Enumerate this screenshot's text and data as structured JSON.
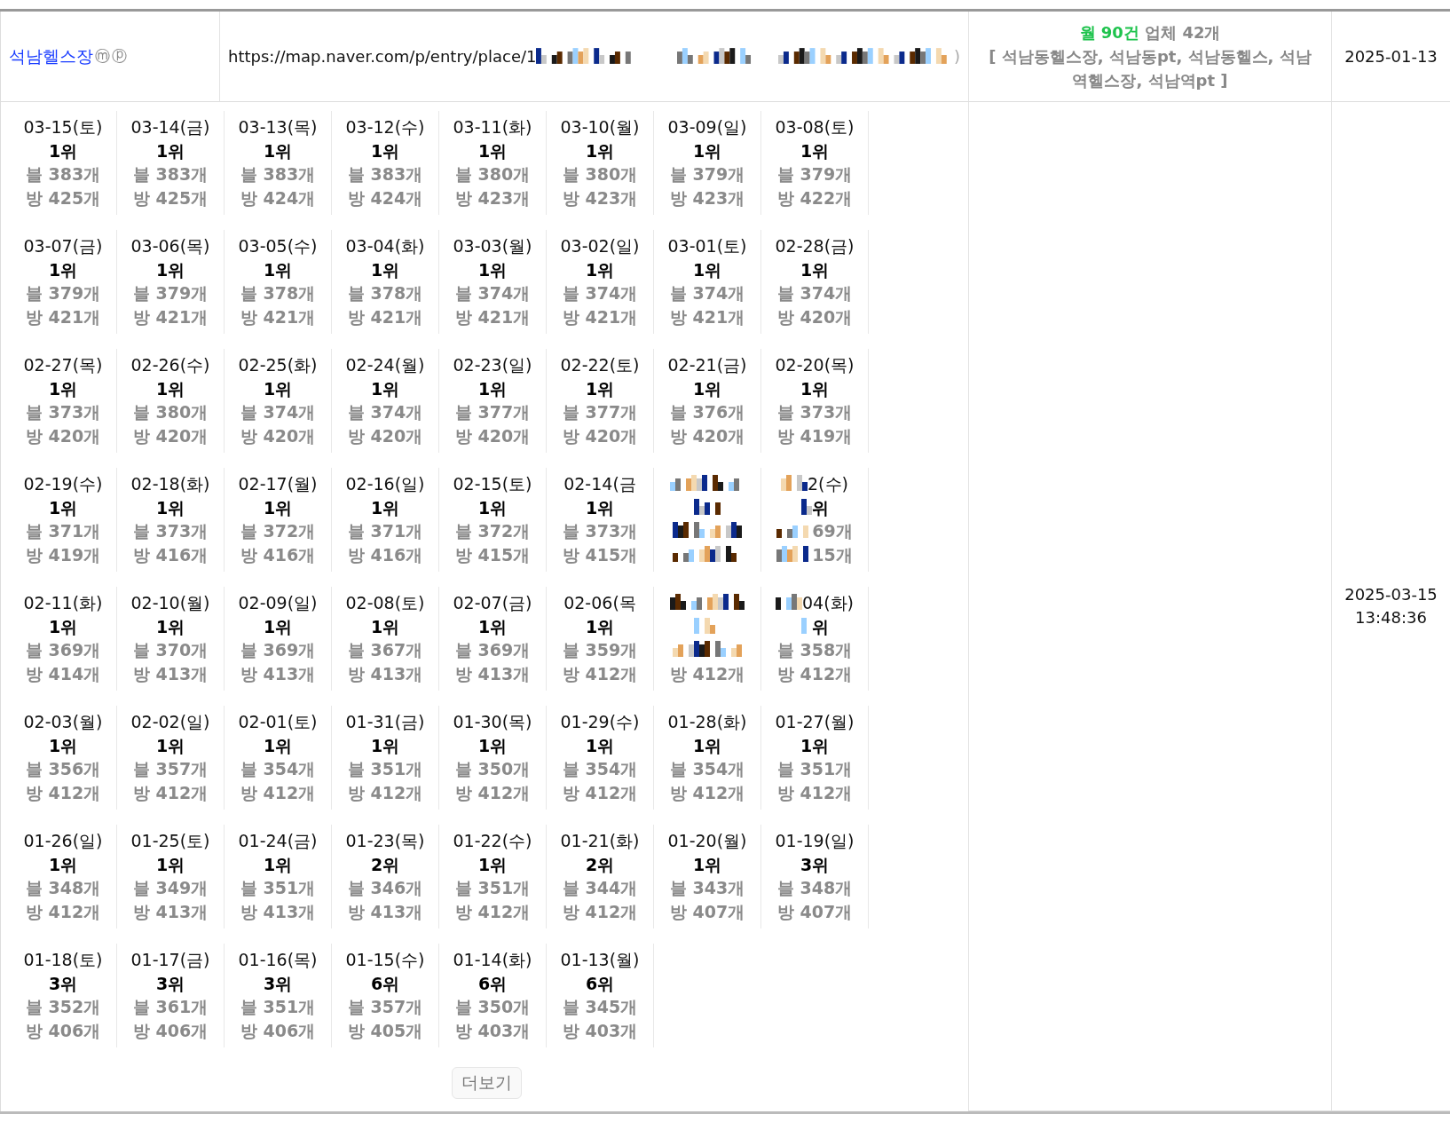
{
  "place_row": {
    "name": "석남헬스장",
    "badges": [
      "ⓜ",
      "ⓟ"
    ],
    "url": "https://map.naver.com/p/entry/place/1",
    "url_tail": ")",
    "monthly": "월 90건",
    "companies": "업체 42개",
    "keywords": "[ 석남동헬스장, 석남동pt, 석남동헬스, 석남역헬스장, 석남역pt ]",
    "start_date": "2025-01-13"
  },
  "rank_row": {
    "timestamp": "2025-03-15 13:48:36",
    "more_button": "더보기",
    "cells": [
      {
        "date": "03-15(토)",
        "rank": "1위",
        "blog": "블 383개",
        "place": "방 425개"
      },
      {
        "date": "03-14(금)",
        "rank": "1위",
        "blog": "블 383개",
        "place": "방 425개"
      },
      {
        "date": "03-13(목)",
        "rank": "1위",
        "blog": "블 383개",
        "place": "방 424개"
      },
      {
        "date": "03-12(수)",
        "rank": "1위",
        "blog": "블 383개",
        "place": "방 424개"
      },
      {
        "date": "03-11(화)",
        "rank": "1위",
        "blog": "블 380개",
        "place": "방 423개"
      },
      {
        "date": "03-10(월)",
        "rank": "1위",
        "blog": "블 380개",
        "place": "방 423개"
      },
      {
        "date": "03-09(일)",
        "rank": "1위",
        "blog": "블 379개",
        "place": "방 423개"
      },
      {
        "date": "03-08(토)",
        "rank": "1위",
        "blog": "블 379개",
        "place": "방 422개"
      },
      {
        "date": "03-07(금)",
        "rank": "1위",
        "blog": "블 379개",
        "place": "방 421개"
      },
      {
        "date": "03-06(목)",
        "rank": "1위",
        "blog": "블 379개",
        "place": "방 421개"
      },
      {
        "date": "03-05(수)",
        "rank": "1위",
        "blog": "블 378개",
        "place": "방 421개"
      },
      {
        "date": "03-04(화)",
        "rank": "1위",
        "blog": "블 378개",
        "place": "방 421개"
      },
      {
        "date": "03-03(월)",
        "rank": "1위",
        "blog": "블 374개",
        "place": "방 421개"
      },
      {
        "date": "03-02(일)",
        "rank": "1위",
        "blog": "블 374개",
        "place": "방 421개"
      },
      {
        "date": "03-01(토)",
        "rank": "1위",
        "blog": "블 374개",
        "place": "방 421개"
      },
      {
        "date": "02-28(금)",
        "rank": "1위",
        "blog": "블 374개",
        "place": "방 420개"
      },
      {
        "date": "02-27(목)",
        "rank": "1위",
        "blog": "블 373개",
        "place": "방 420개"
      },
      {
        "date": "02-26(수)",
        "rank": "1위",
        "blog": "블 380개",
        "place": "방 420개"
      },
      {
        "date": "02-25(화)",
        "rank": "1위",
        "blog": "블 374개",
        "place": "방 420개"
      },
      {
        "date": "02-24(월)",
        "rank": "1위",
        "blog": "블 374개",
        "place": "방 420개"
      },
      {
        "date": "02-23(일)",
        "rank": "1위",
        "blog": "블 377개",
        "place": "방 420개"
      },
      {
        "date": "02-22(토)",
        "rank": "1위",
        "blog": "블 377개",
        "place": "방 420개"
      },
      {
        "date": "02-21(금)",
        "rank": "1위",
        "blog": "블 376개",
        "place": "방 420개"
      },
      {
        "date": "02-20(목)",
        "rank": "1위",
        "blog": "블 373개",
        "place": "방 419개"
      },
      {
        "date": "02-19(수)",
        "rank": "1위",
        "blog": "블 371개",
        "place": "방 419개"
      },
      {
        "date": "02-18(화)",
        "rank": "1위",
        "blog": "블 373개",
        "place": "방 416개"
      },
      {
        "date": "02-17(월)",
        "rank": "1위",
        "blog": "블 372개",
        "place": "방 416개"
      },
      {
        "date": "02-16(일)",
        "rank": "1위",
        "blog": "블 371개",
        "place": "방 416개"
      },
      {
        "date": "02-15(토)",
        "rank": "1위",
        "blog": "블 372개",
        "place": "방 415개"
      },
      {
        "date": "02-14(금",
        "rank": "1위",
        "blog": "블 373개",
        "place": "방 415개"
      },
      {
        "masked": true
      },
      {
        "masked": true,
        "date": "2(수)",
        "rank": "위",
        "blog": "69개",
        "place": "15개"
      },
      {
        "date": "02-11(화)",
        "rank": "1위",
        "blog": "블 369개",
        "place": "방 414개"
      },
      {
        "date": "02-10(월)",
        "rank": "1위",
        "blog": "블 370개",
        "place": "방 413개"
      },
      {
        "date": "02-09(일)",
        "rank": "1위",
        "blog": "블 369개",
        "place": "방 413개"
      },
      {
        "date": "02-08(토)",
        "rank": "1위",
        "blog": "블 367개",
        "place": "방 413개"
      },
      {
        "date": "02-07(금)",
        "rank": "1위",
        "blog": "블 369개",
        "place": "방 413개"
      },
      {
        "date": "02-06(목",
        "rank": "1위",
        "blog": "블 359개",
        "place": "방 412개"
      },
      {
        "masked": true,
        "place": "방 412개"
      },
      {
        "masked": true,
        "date": "04(화)",
        "rank": "위",
        "blog": "블 358개",
        "place": "방 412개"
      },
      {
        "date": "02-03(월)",
        "rank": "1위",
        "blog": "블 356개",
        "place": "방 412개"
      },
      {
        "date": "02-02(일)",
        "rank": "1위",
        "blog": "블 357개",
        "place": "방 412개"
      },
      {
        "date": "02-01(토)",
        "rank": "1위",
        "blog": "블 354개",
        "place": "방 412개"
      },
      {
        "date": "01-31(금)",
        "rank": "1위",
        "blog": "블 351개",
        "place": "방 412개"
      },
      {
        "date": "01-30(목)",
        "rank": "1위",
        "blog": "블 350개",
        "place": "방 412개"
      },
      {
        "date": "01-29(수)",
        "rank": "1위",
        "blog": "블 354개",
        "place": "방 412개"
      },
      {
        "date": "01-28(화)",
        "rank": "1위",
        "blog": "블 354개",
        "place": "방 412개"
      },
      {
        "date": "01-27(월)",
        "rank": "1위",
        "blog": "블 351개",
        "place": "방 412개"
      },
      {
        "date": "01-26(일)",
        "rank": "1위",
        "blog": "블 348개",
        "place": "방 412개"
      },
      {
        "date": "01-25(토)",
        "rank": "1위",
        "blog": "블 349개",
        "place": "방 413개"
      },
      {
        "date": "01-24(금)",
        "rank": "1위",
        "blog": "블 351개",
        "place": "방 413개"
      },
      {
        "date": "01-23(목)",
        "rank": "2위",
        "blog": "블 346개",
        "place": "방 413개"
      },
      {
        "date": "01-22(수)",
        "rank": "1위",
        "blog": "블 351개",
        "place": "방 412개"
      },
      {
        "date": "01-21(화)",
        "rank": "2위",
        "blog": "블 344개",
        "place": "방 412개"
      },
      {
        "date": "01-20(월)",
        "rank": "1위",
        "blog": "블 343개",
        "place": "방 407개"
      },
      {
        "date": "01-19(일)",
        "rank": "3위",
        "blog": "블 348개",
        "place": "방 407개"
      },
      {
        "date": "01-18(토)",
        "rank": "3위",
        "blog": "블 352개",
        "place": "방 406개"
      },
      {
        "date": "01-17(금)",
        "rank": "3위",
        "blog": "블 361개",
        "place": "방 406개"
      },
      {
        "date": "01-16(목)",
        "rank": "3위",
        "blog": "블 351개",
        "place": "방 406개"
      },
      {
        "date": "01-15(수)",
        "rank": "6위",
        "blog": "블 357개",
        "place": "방 405개"
      },
      {
        "date": "01-14(화)",
        "rank": "6위",
        "blog": "블 350개",
        "place": "방 403개"
      },
      {
        "date": "01-13(월)",
        "rank": "6위",
        "blog": "블 345개",
        "place": "방 403개"
      }
    ]
  }
}
